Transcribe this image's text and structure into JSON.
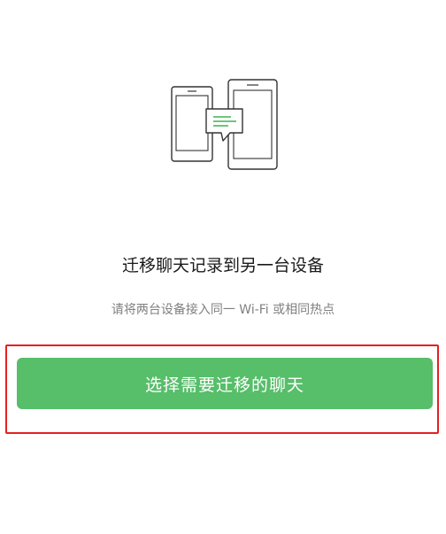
{
  "illustration": {
    "icon": "phone-transfer-icon",
    "stroke_color": "#333333",
    "accent_color": "#57be6a"
  },
  "title": "迁移聊天记录到另一台设备",
  "subtitle": "请将两台设备接入同一 Wi-Fi 或相同热点",
  "primary_button": {
    "label": "选择需要迁移的聊天",
    "color": "#57be6a"
  },
  "highlight_color": "#e52020"
}
